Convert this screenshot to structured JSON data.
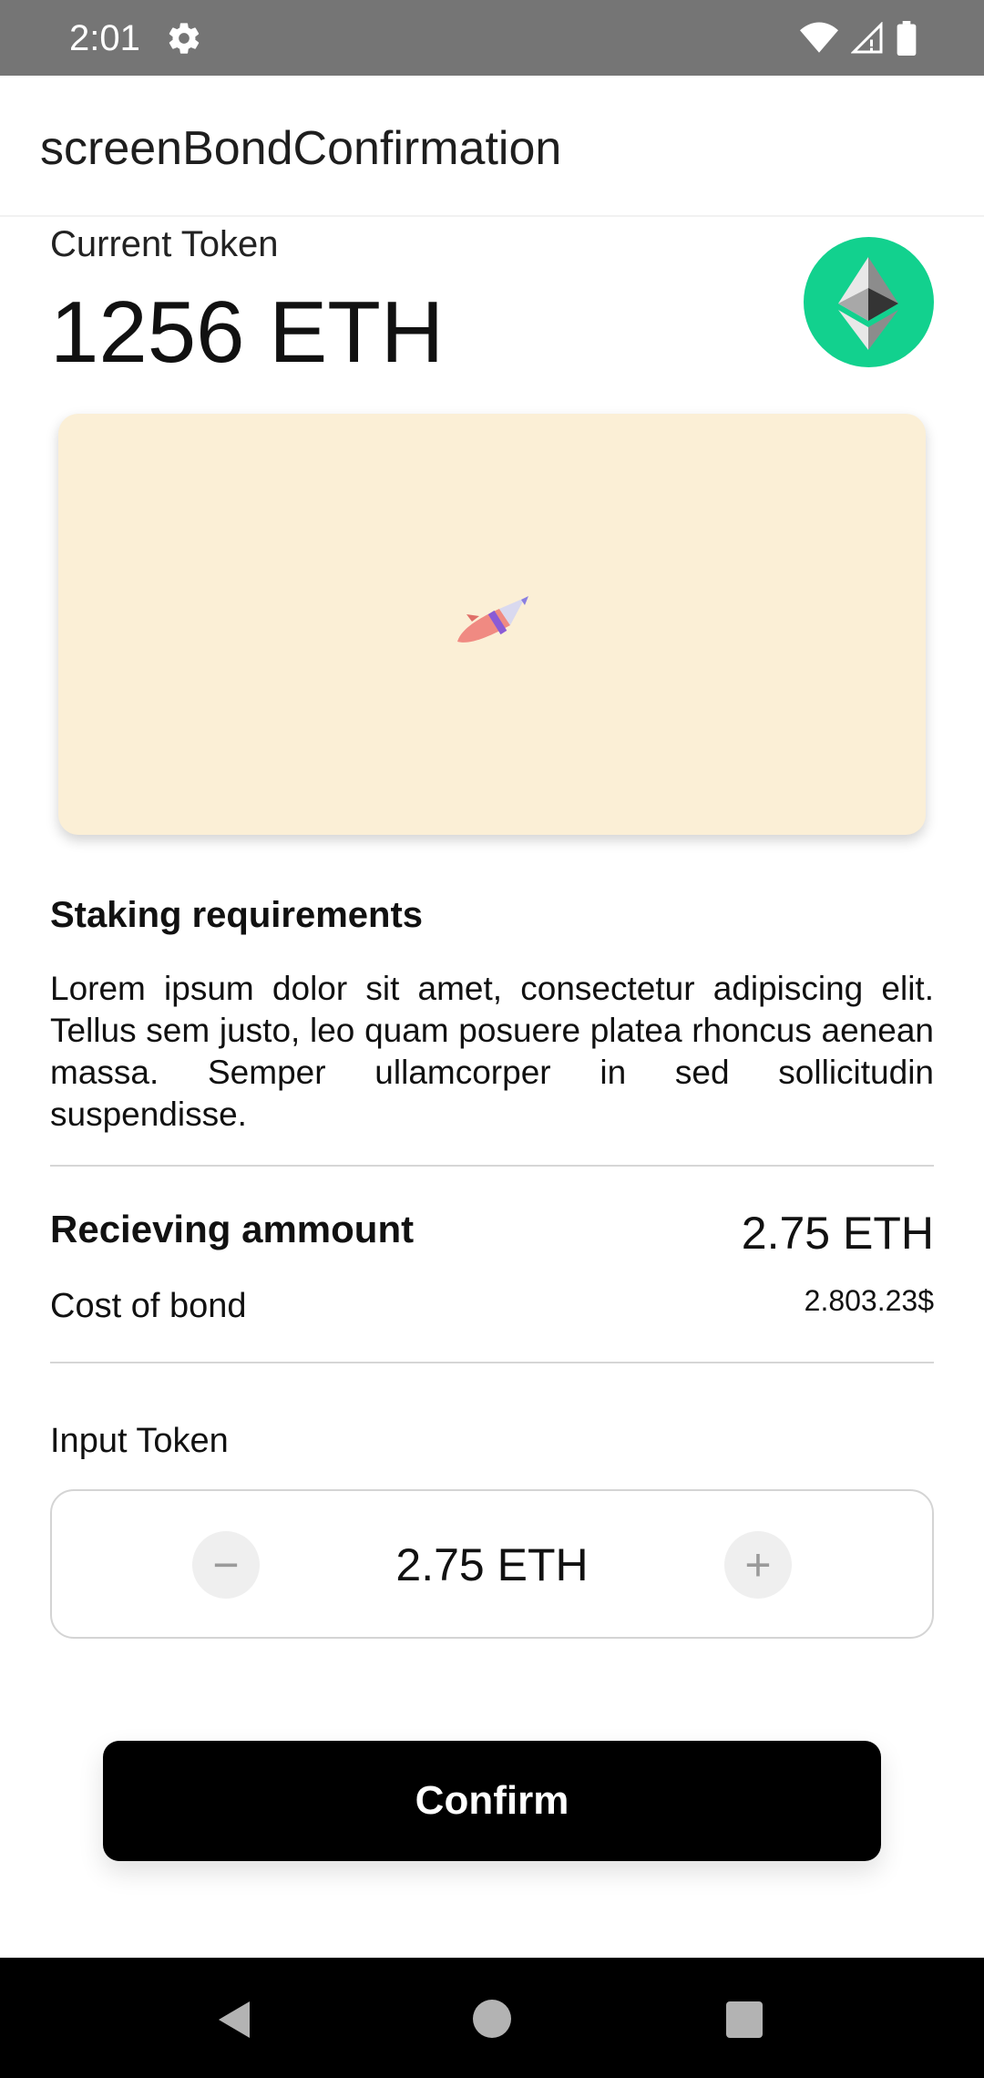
{
  "status_bar": {
    "time": "2:01",
    "icons": [
      "gear-icon",
      "wifi-icon",
      "signal-icon",
      "battery-icon"
    ]
  },
  "app_bar": {
    "title": "screenBondConfirmation"
  },
  "current_token": {
    "label": "Current Token",
    "value": "1256 ETH",
    "icon": "ethereum-logo-icon"
  },
  "banner": {
    "illustration": "rocket-icon",
    "background_color": "#fbefd6"
  },
  "staking": {
    "title": "Staking requirements",
    "body": "Lorem ipsum dolor sit amet, consectetur adipiscing elit. Tellus sem justo, leo quam posuere platea rhoncus aenean massa. Semper ullamcorper in sed sollicitudin suspendisse."
  },
  "summary": {
    "receiving_label": "Recieving ammount",
    "receiving_value": "2.75 ETH",
    "cost_label": "Cost of bond",
    "cost_value": "2.803.23$"
  },
  "input_token": {
    "label": "Input Token",
    "value": "2.75 ETH",
    "decrement_symbol": "−",
    "increment_symbol": "+"
  },
  "confirm_button": {
    "label": "Confirm"
  },
  "colors": {
    "accent_green": "#12d18e",
    "status_bar": "#757575",
    "button": "#000000"
  }
}
